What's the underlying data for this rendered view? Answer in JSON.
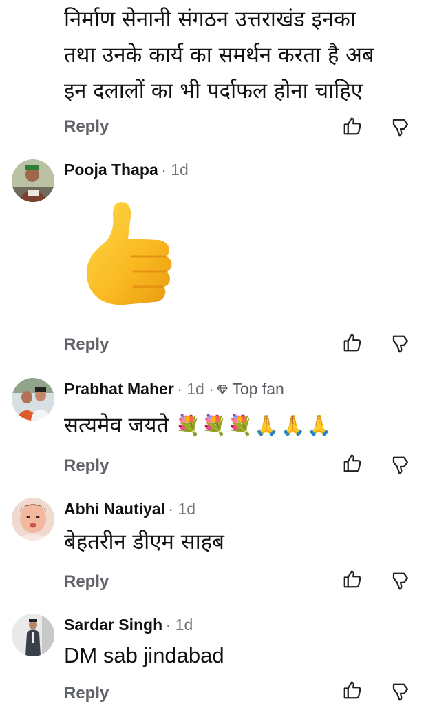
{
  "comments": [
    {
      "text_lines": [
        "निर्माण सेनानी संगठन उत्तराखंड इनका",
        "तथा उनके कार्य का समर्थन करता है अब",
        "इन दलालों का भी पर्दाफल होना चाहिए"
      ],
      "reply": "Reply"
    },
    {
      "author": "Pooja Thapa",
      "time": "· 1d",
      "sticker": "thumbs-up",
      "reply": "Reply"
    },
    {
      "author": "Prabhat Maher",
      "time": "· 1d ·",
      "badge": "Top fan",
      "text": "सत्यमेव जयते",
      "emojis": "💐💐💐🙏🙏🙏",
      "reply": "Reply"
    },
    {
      "author": "Abhi Nautiyal",
      "time": "· 1d",
      "text": "बेहतरीन डीएम साहब",
      "reply": "Reply"
    },
    {
      "author": "Sardar Singh",
      "time": "· 1d",
      "text": "DM sab jindabad",
      "reply": "Reply"
    }
  ],
  "icons": {
    "like": "thumbs-up-outline-icon",
    "dislike": "thumbs-down-outline-icon"
  },
  "colors": {
    "text": "#111111",
    "meta": "#757575",
    "reply": "#606368",
    "sticker": "#f7b51c"
  }
}
